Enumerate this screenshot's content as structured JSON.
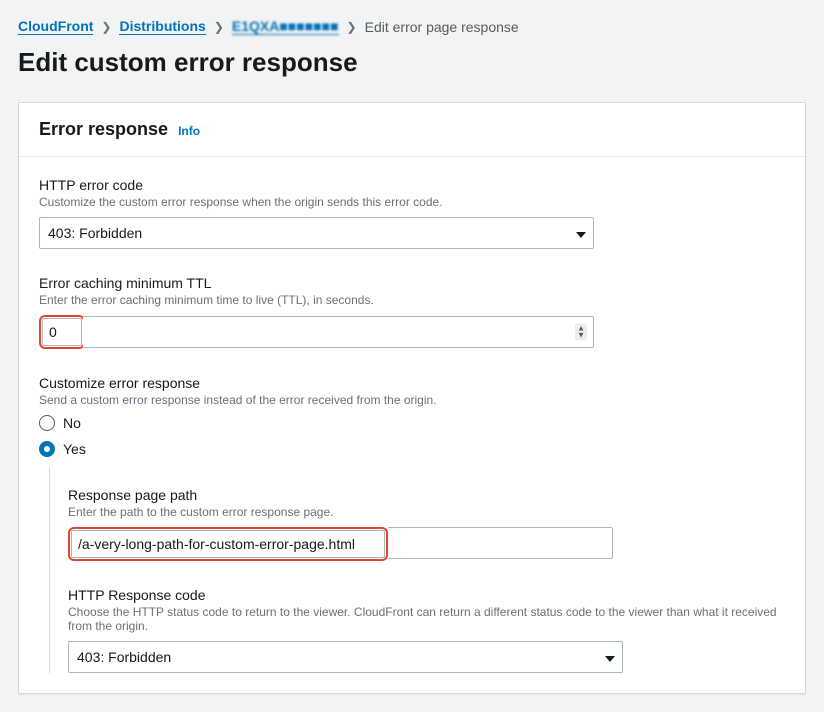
{
  "breadcrumbs": {
    "items": [
      {
        "label": "CloudFront"
      },
      {
        "label": "Distributions"
      },
      {
        "label": "E1QXA■■■■■■■"
      }
    ],
    "current": "Edit error page response"
  },
  "page_title": "Edit custom error response",
  "panel": {
    "title": "Error response",
    "info": "Info"
  },
  "fields": {
    "http_error_code": {
      "label": "HTTP error code",
      "help": "Customize the custom error response when the origin sends this error code.",
      "value": "403: Forbidden"
    },
    "caching_ttl": {
      "label": "Error caching minimum TTL",
      "help": "Enter the error caching minimum time to live (TTL), in seconds.",
      "value": "0"
    },
    "customize": {
      "label": "Customize error response",
      "help": "Send a custom error response instead of the error received from the origin.",
      "options": {
        "no": "No",
        "yes": "Yes"
      },
      "selected": "yes"
    },
    "response_page_path": {
      "label": "Response page path",
      "help": "Enter the path to the custom error response page.",
      "value": "/a-very-long-path-for-custom-error-page.html"
    },
    "http_response_code": {
      "label": "HTTP Response code",
      "help": "Choose the HTTP status code to return to the viewer. CloudFront can return a different status code to the viewer than what it received from the origin.",
      "value": "403: Forbidden"
    }
  }
}
